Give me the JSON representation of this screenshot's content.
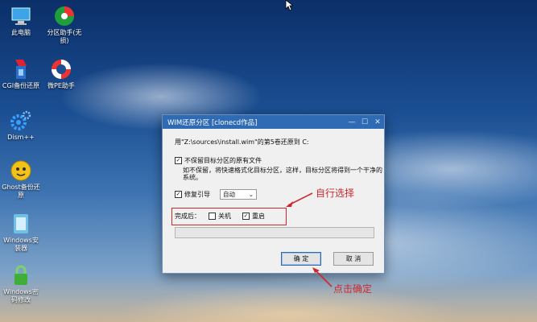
{
  "desktop": {
    "icons": [
      {
        "label": "此电脑",
        "icon": "computer-icon"
      },
      {
        "label": "分区助手(无损)",
        "icon": "partition-assistant-icon"
      },
      {
        "label": "CGI备份还原",
        "icon": "cgi-backup-icon"
      },
      {
        "label": "微PE助手",
        "icon": "lifebuoy-icon"
      },
      {
        "label": "Dism++",
        "icon": "gears-icon"
      },
      {
        "label": "Ghost备份还原",
        "icon": "ghost-icon"
      },
      {
        "label": "Windows安装器",
        "icon": "windows-installer-icon"
      },
      {
        "label": "Windows密码修改",
        "icon": "password-lock-icon"
      }
    ]
  },
  "dialog": {
    "title": "WIM还原分区 [clonecd作品]",
    "line1": "用\"Z:\\sources\\install.wim\"的第5卷还原到 C:",
    "keep_label": "不保留目标分区的原有文件",
    "keep_desc_1": "如不保留，将快速格式化目标分区，这样，目标分区将得到一个干净的",
    "keep_desc_2": "系统。",
    "repair_label": "修复引导",
    "repair_value": "自动",
    "after_label": "完成后：",
    "shutdown_label": "关机",
    "restart_label": "重启",
    "ok_label": "确 定",
    "cancel_label": "取 消"
  },
  "annotations": {
    "auto_select": "自行选择",
    "click_ok": "点击确定"
  },
  "colors": {
    "accent": "#2f6bb5",
    "annotation": "#d0282a"
  }
}
